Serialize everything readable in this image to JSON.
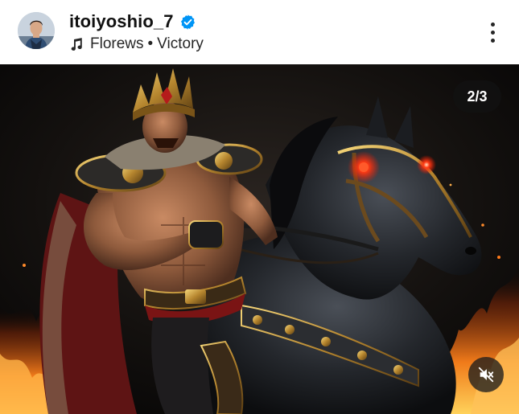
{
  "post": {
    "username": "itoiyoshio_7",
    "verified": true,
    "audio": {
      "artist": "Florews",
      "separator": "•",
      "title": "Victory"
    }
  },
  "media": {
    "counter": "2/3",
    "description_icons": {
      "more": "more-vertical-icon",
      "mute": "speaker-muted-icon",
      "music": "music-note-icon",
      "verified": "verified-badge-icon"
    }
  },
  "colors": {
    "verified_blue": "#0095f6",
    "text_primary": "#111111",
    "badge_bg": "#121212"
  }
}
